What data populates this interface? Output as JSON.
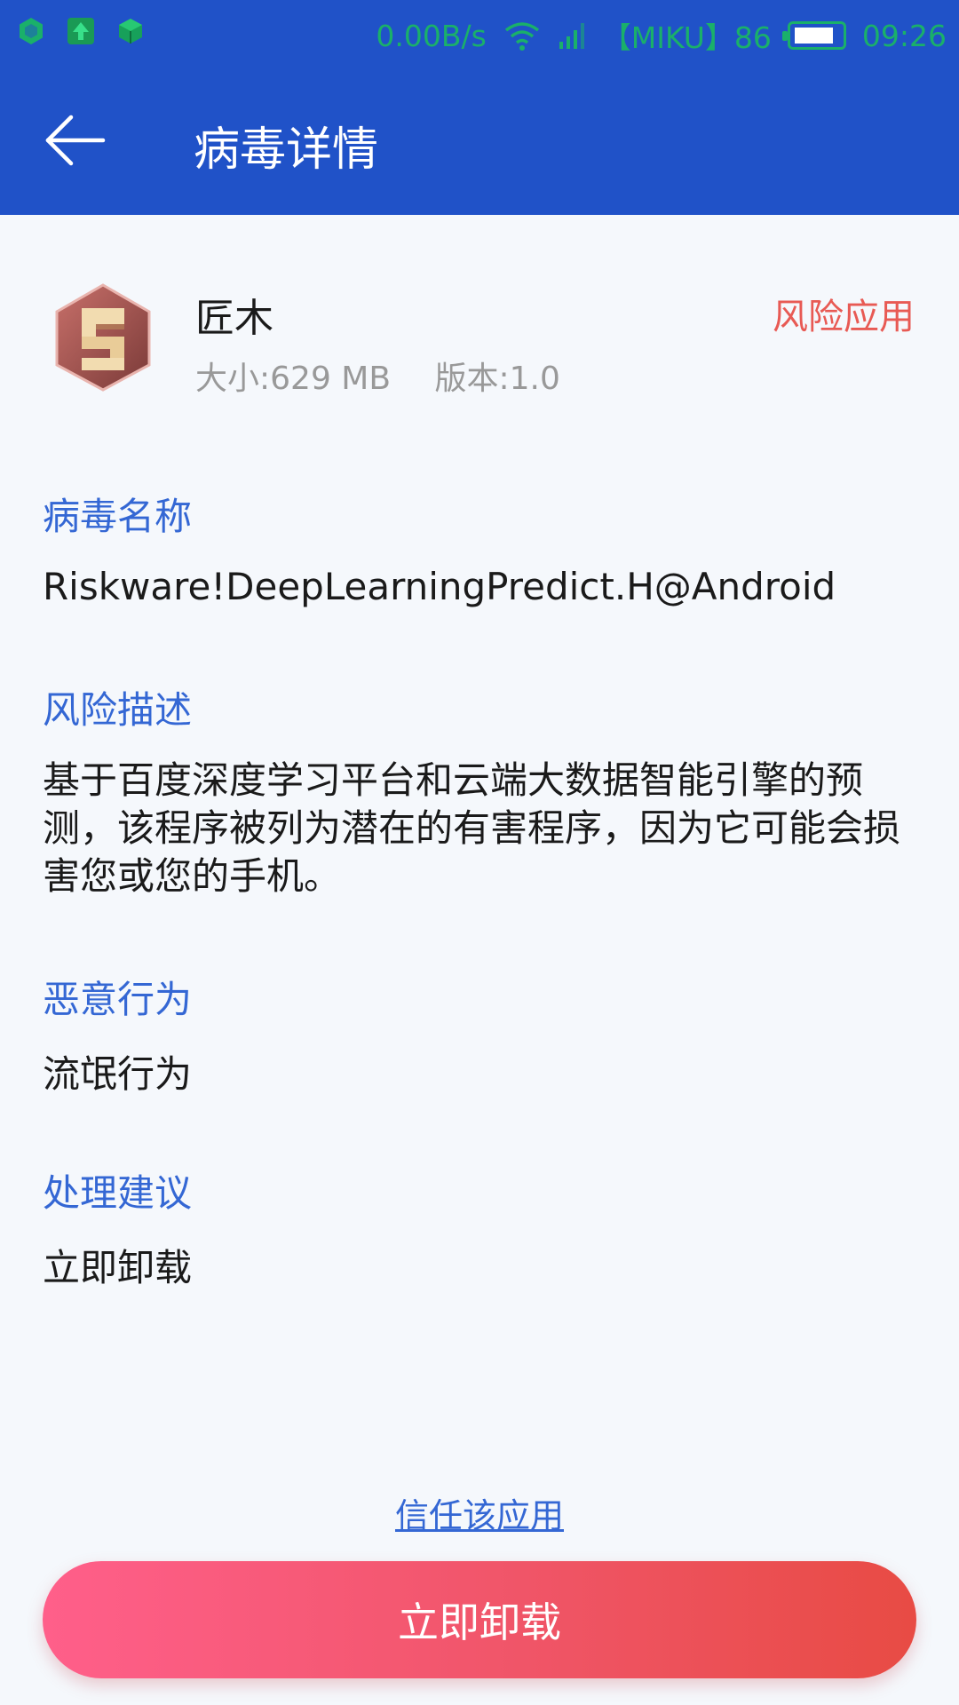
{
  "status_bar": {
    "net_speed": "0.00B/s",
    "carrier": "【MIKU】86",
    "time": "09:26",
    "battery_level": 0.86,
    "icons": [
      "hexagon-notification-icon",
      "upload-notification-icon",
      "cube-notification-icon",
      "wifi-icon",
      "signal-icon",
      "battery-icon"
    ]
  },
  "app_bar": {
    "title": "病毒详情"
  },
  "app_info": {
    "name": "匠木",
    "size": "大小:629 MB",
    "version": "版本:1.0",
    "risk_badge": "风险应用"
  },
  "sections": {
    "virus_name": {
      "heading": "病毒名称",
      "value": "Riskware!DeepLearningPredict.H@Android"
    },
    "risk_desc": {
      "heading": "风险描述",
      "value": "基于百度深度学习平台和云端大数据智能引擎的预测，该程序被列为潜在的有害程序，因为它可能会损害您或您的手机。"
    },
    "malicious_behavior": {
      "heading": "恶意行为",
      "value": "流氓行为"
    },
    "suggestion": {
      "heading": "处理建议",
      "value": "立即卸载"
    }
  },
  "actions": {
    "trust_link": "信任该应用",
    "uninstall_button": "立即卸载"
  },
  "colors": {
    "app_bar_bg": "#2052c8",
    "page_bg": "#f5f8fc",
    "accent_blue": "#3467d4",
    "risk_red": "#e85a54",
    "status_green": "#1ab06a",
    "button_gradient_start": "#ff5f8a",
    "button_gradient_end": "#e84b44"
  }
}
